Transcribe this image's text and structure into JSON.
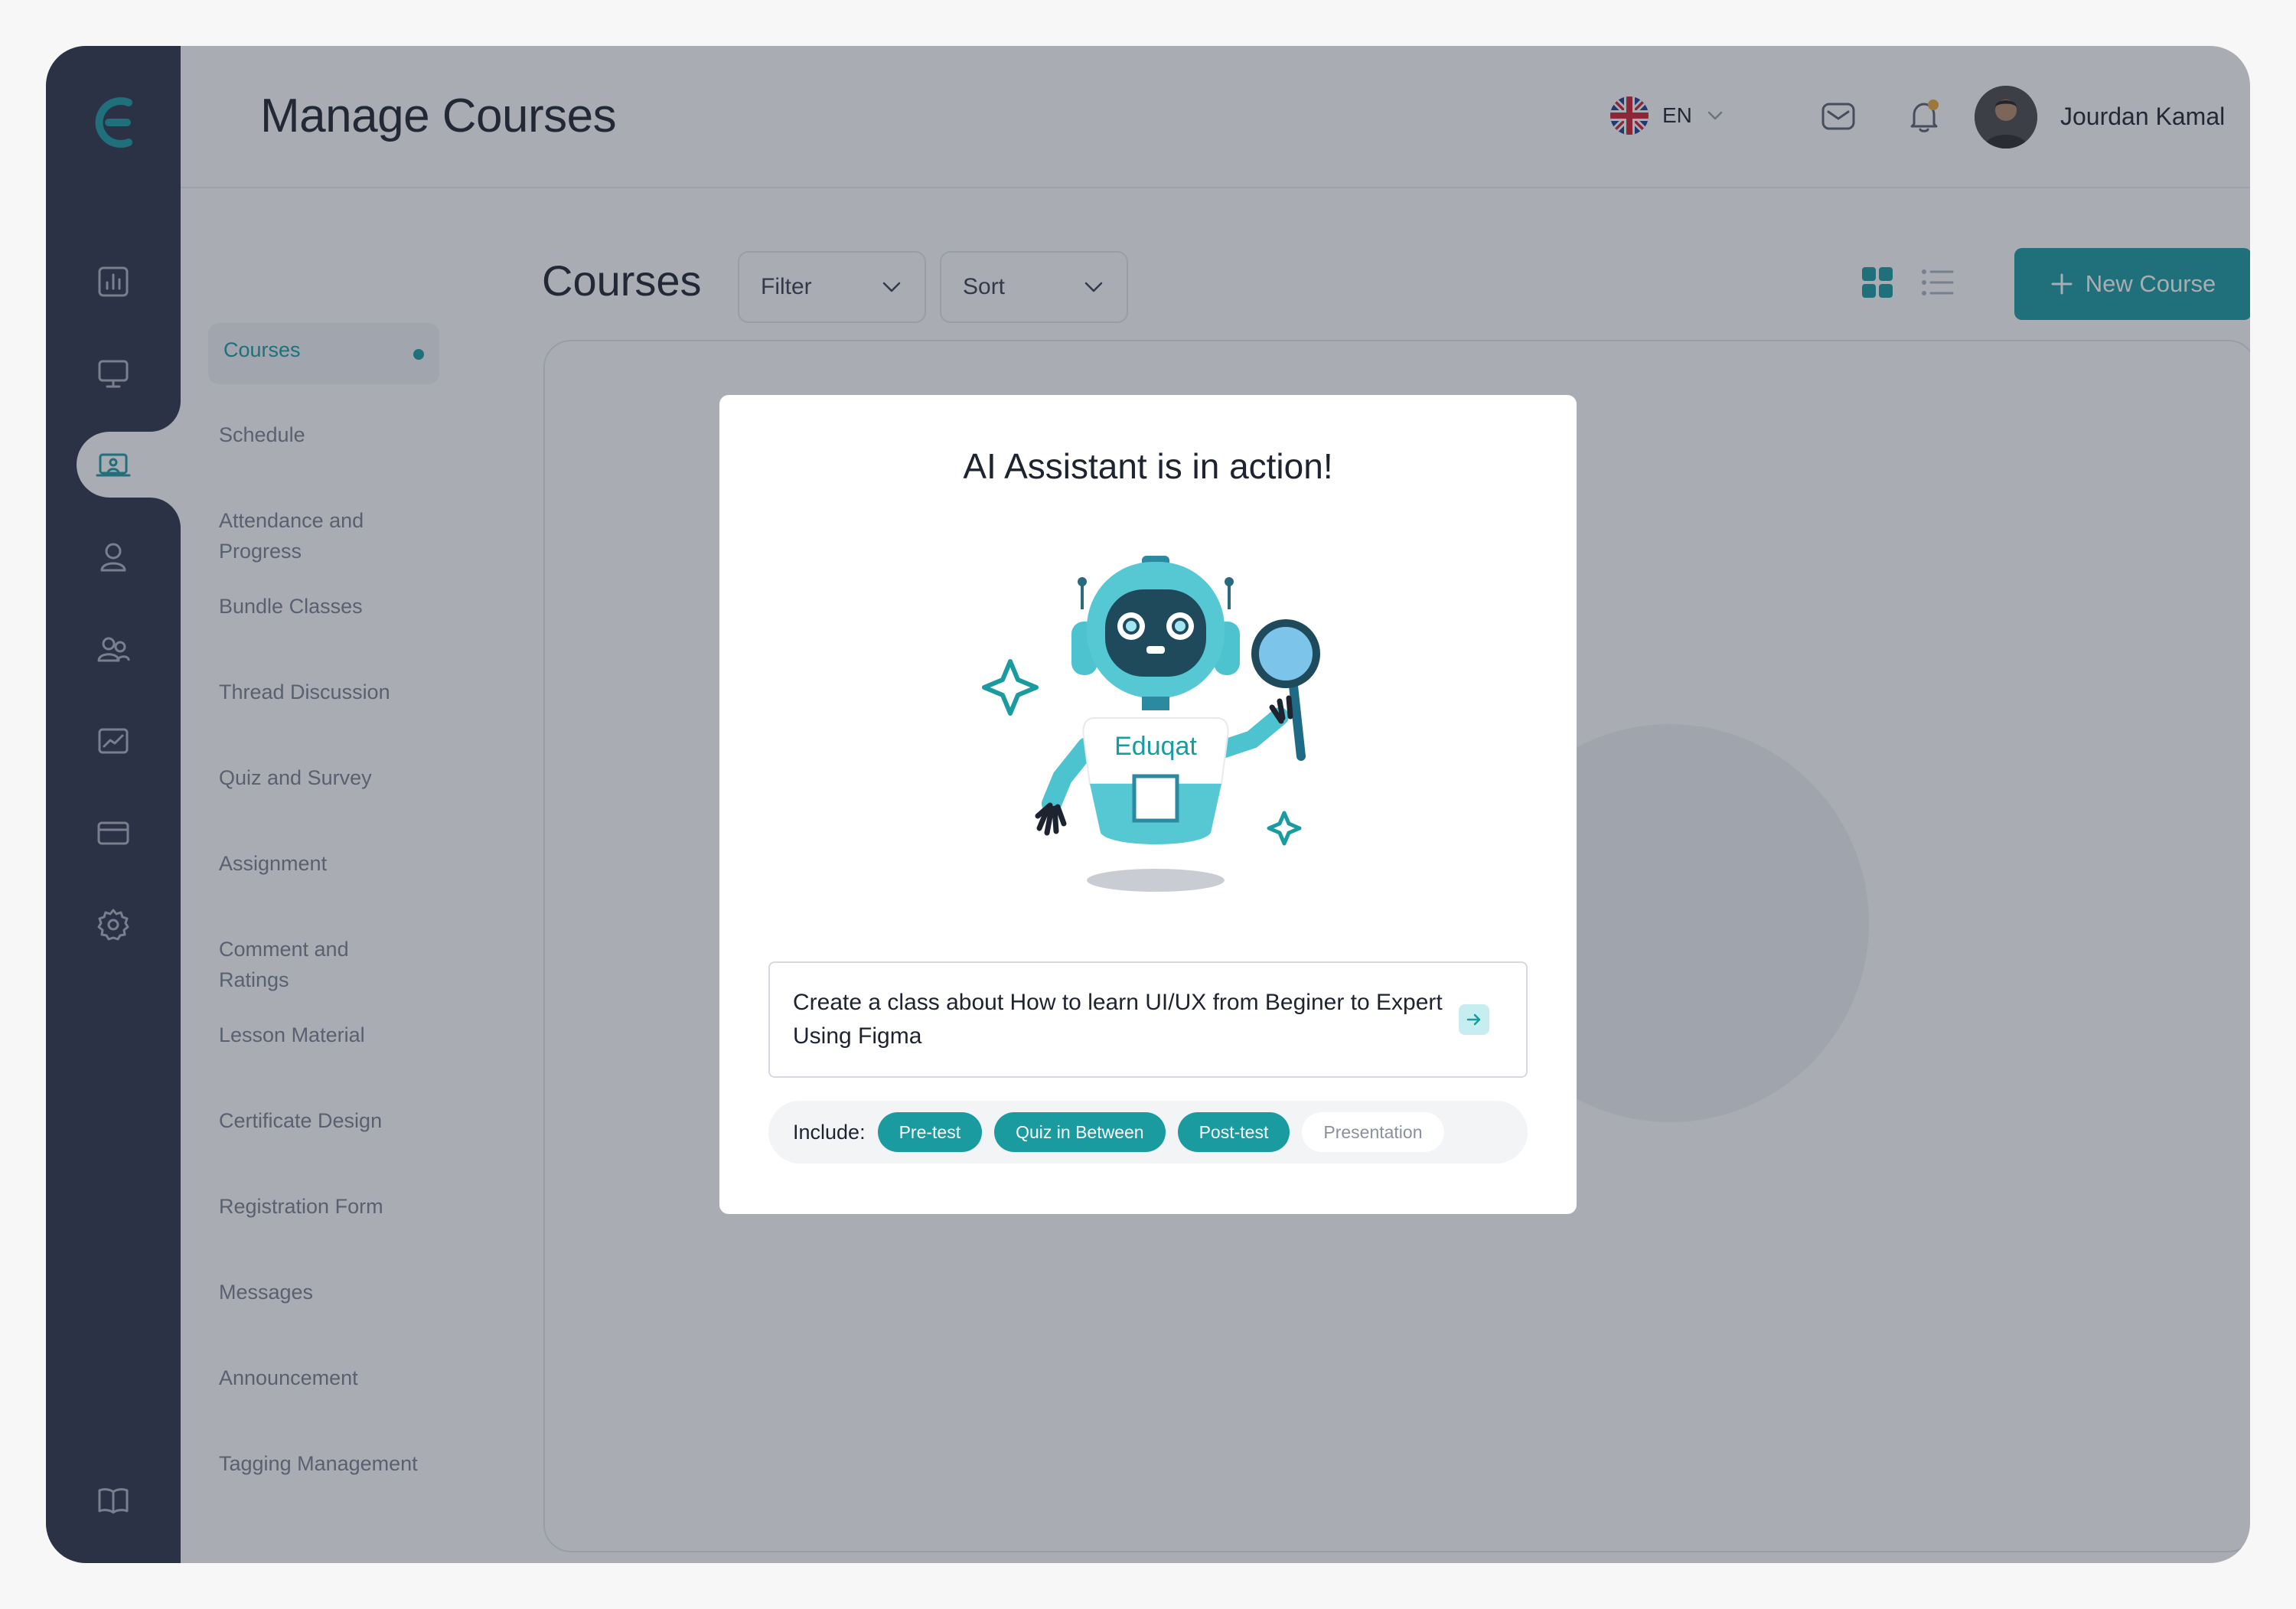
{
  "colors": {
    "accent": "#1a9ba0",
    "rail": "#2d3548",
    "notification_dot": "#e8a93a"
  },
  "header": {
    "title": "Manage Courses",
    "language": "EN",
    "user_name": "Jourdan Kamal"
  },
  "rail": {
    "icons": [
      "dashboard-icon",
      "monitor-icon",
      "classroom-icon",
      "user-icon",
      "users-icon",
      "analytics-icon",
      "card-icon",
      "settings-icon",
      "book-icon"
    ],
    "active": "classroom-icon"
  },
  "subnav": {
    "items": [
      {
        "label": "Courses",
        "active": true
      },
      {
        "label": "Schedule"
      },
      {
        "label": "Attendance and Progress"
      },
      {
        "label": "Bundle Classes"
      },
      {
        "label": "Thread Discussion"
      },
      {
        "label": "Quiz and Survey"
      },
      {
        "label": "Assignment"
      },
      {
        "label": "Comment and Ratings"
      },
      {
        "label": "Lesson Material"
      },
      {
        "label": "Certificate Design"
      },
      {
        "label": "Registration Form"
      },
      {
        "label": "Messages"
      },
      {
        "label": "Announcement"
      },
      {
        "label": "Tagging Management"
      }
    ]
  },
  "main": {
    "title": "Courses",
    "filter_label": "Filter",
    "sort_label": "Sort",
    "new_course_label": "New Course",
    "view_mode": "grid"
  },
  "modal": {
    "title": "AI Assistant is in action!",
    "robot_label": "Eduqat",
    "prompt": "Create a class about How to learn UI/UX from Beginer to Expert Using Figma",
    "include_label": "Include:",
    "chips": [
      {
        "label": "Pre-test",
        "selected": true
      },
      {
        "label": "Quiz in Between",
        "selected": true
      },
      {
        "label": "Post-test",
        "selected": true
      },
      {
        "label": "Presentation",
        "selected": false
      }
    ]
  }
}
